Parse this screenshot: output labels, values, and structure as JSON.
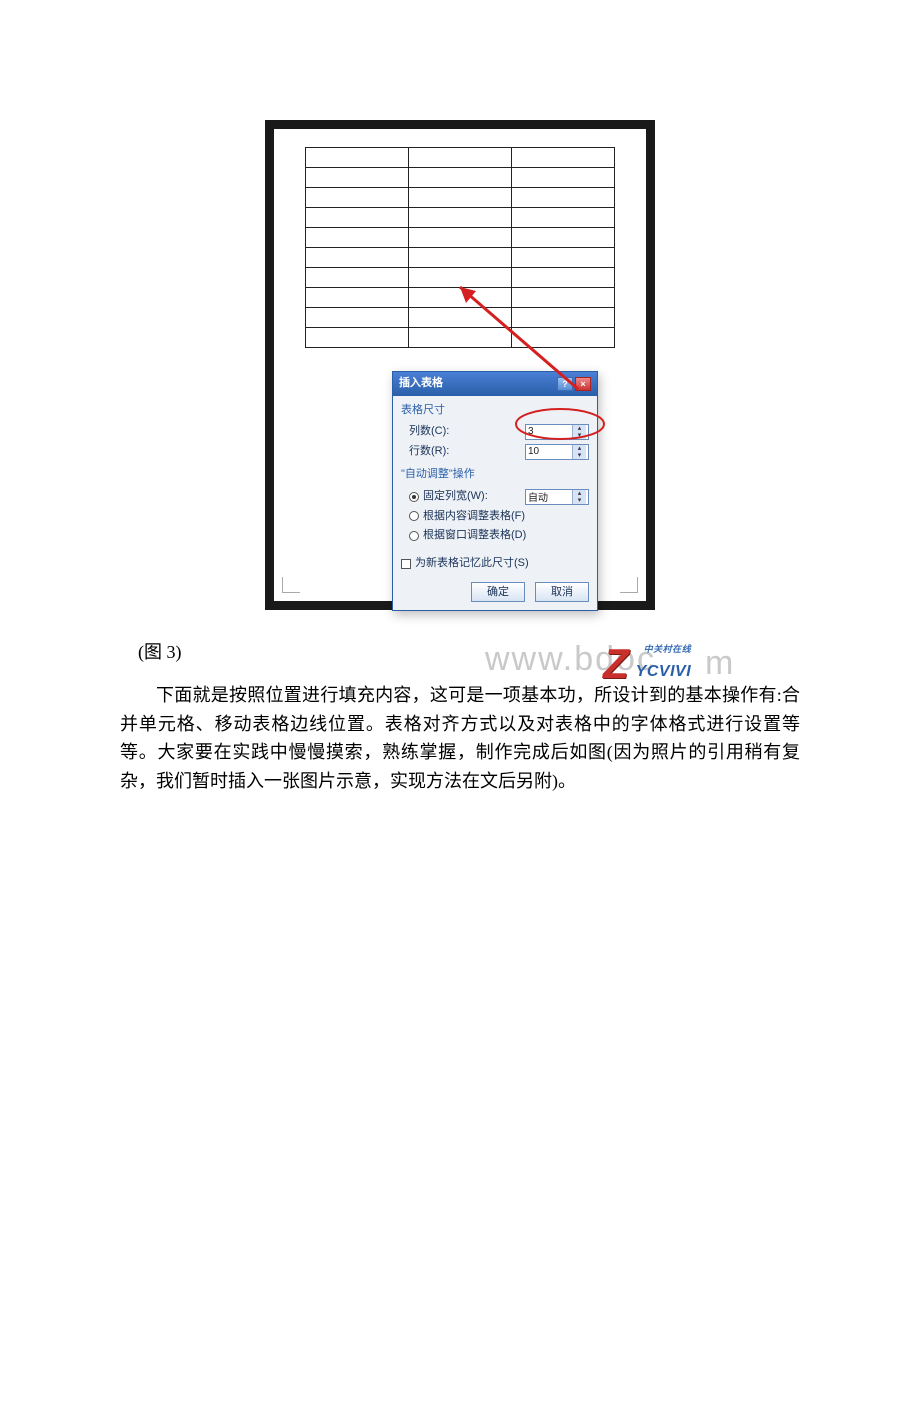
{
  "figure": {
    "table": {
      "rows": 10,
      "cols": 3
    },
    "dialog": {
      "title": "插入表格",
      "section_size": "表格尺寸",
      "cols_label": "列数(C):",
      "rows_label": "行数(R):",
      "cols_value": "3",
      "rows_value": "10",
      "section_auto": "\"自动调整\"操作",
      "opt_fixed": "固定列宽(W):",
      "opt_fixed_value": "自动",
      "opt_content": "根据内容调整表格(F)",
      "opt_window": "根据窗口调整表格(D)",
      "remember": "为新表格记忆此尺寸(S)",
      "ok": "确定",
      "cancel": "取消"
    },
    "watermark": "www.bdoc",
    "logo_small": "中关村在线",
    "logo_big": "YCVIVI",
    "logo_trail": "m"
  },
  "caption": "(图 3)",
  "paragraph": "下面就是按照位置进行填充内容，这可是一项基本功，所设计到的基本操作有:合并单元格、移动表格边线位置。表格对齐方式以及对表格中的字体格式进行设置等等。大家要在实践中慢慢摸索，熟练掌握，制作完成后如图(因为照片的引用稍有复杂，我们暂时插入一张图片示意，实现方法在文后另附)。"
}
